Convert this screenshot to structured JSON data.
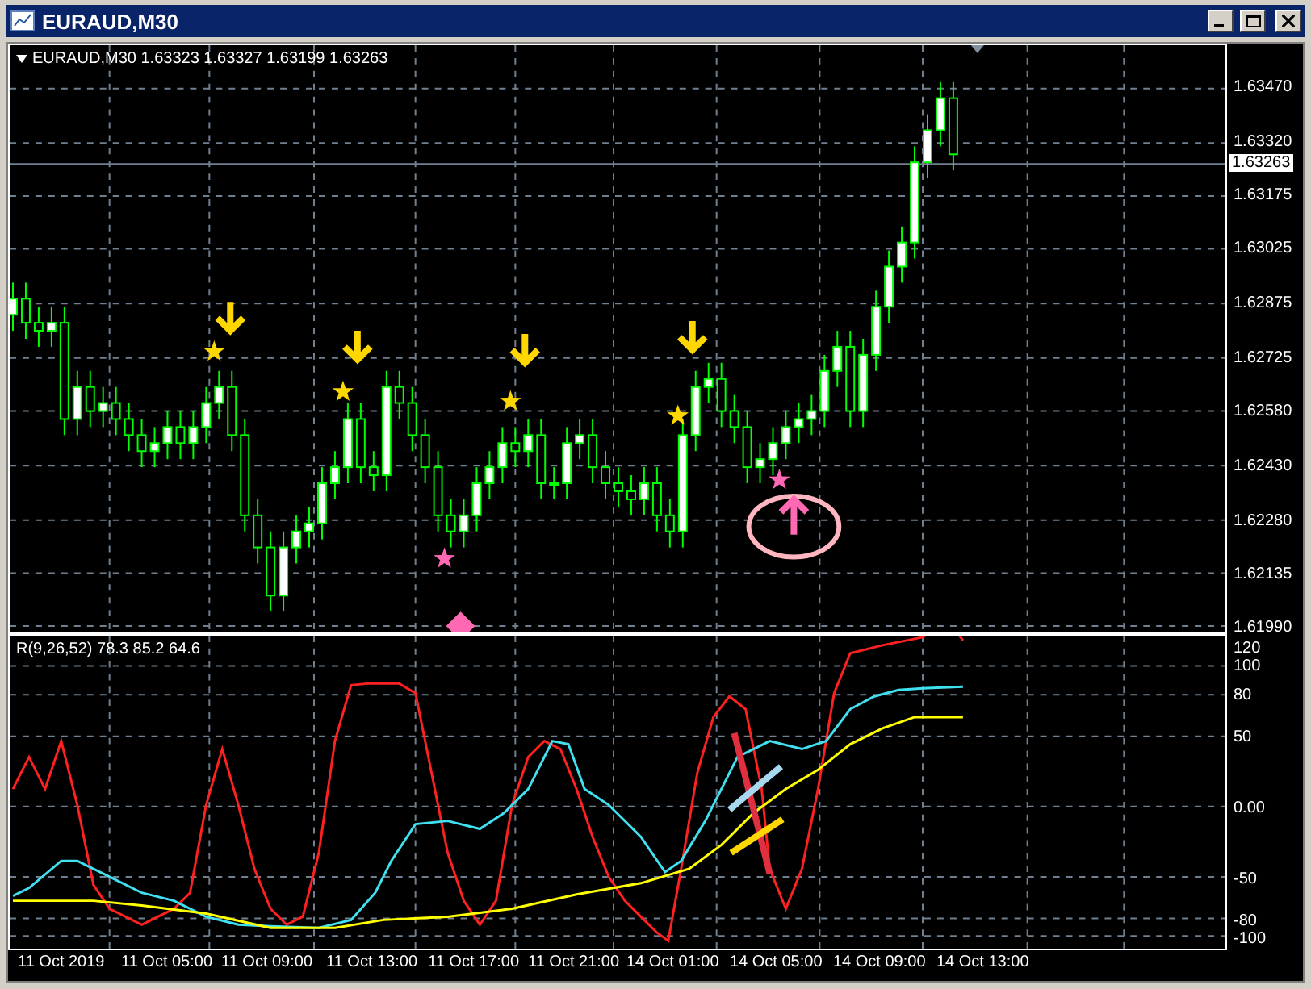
{
  "window": {
    "title": "EURAUD,M30"
  },
  "chart": {
    "legend": "EURAUD,M30  1.63323 1.63327 1.63199 1.63263",
    "price_axis": [
      "1.63470",
      "1.63320",
      "1.63175",
      "1.63025",
      "1.62875",
      "1.62725",
      "1.62580",
      "1.62430",
      "1.62280",
      "1.62135",
      "1.61990"
    ],
    "current_price": "1.63263"
  },
  "indicator": {
    "label": "R(9,26,52) 78.3 85.2 64.6",
    "axis": [
      "120",
      "100",
      "80",
      "50",
      "0.00",
      "-50",
      "-80",
      "-100"
    ]
  },
  "time_axis": [
    "11 Oct 2019",
    "11 Oct 05:00",
    "11 Oct 09:00",
    "11 Oct 13:00",
    "11 Oct 17:00",
    "11 Oct 21:00",
    "14 Oct 01:00",
    "14 Oct 05:00",
    "14 Oct 09:00",
    "14 Oct 13:00"
  ]
}
